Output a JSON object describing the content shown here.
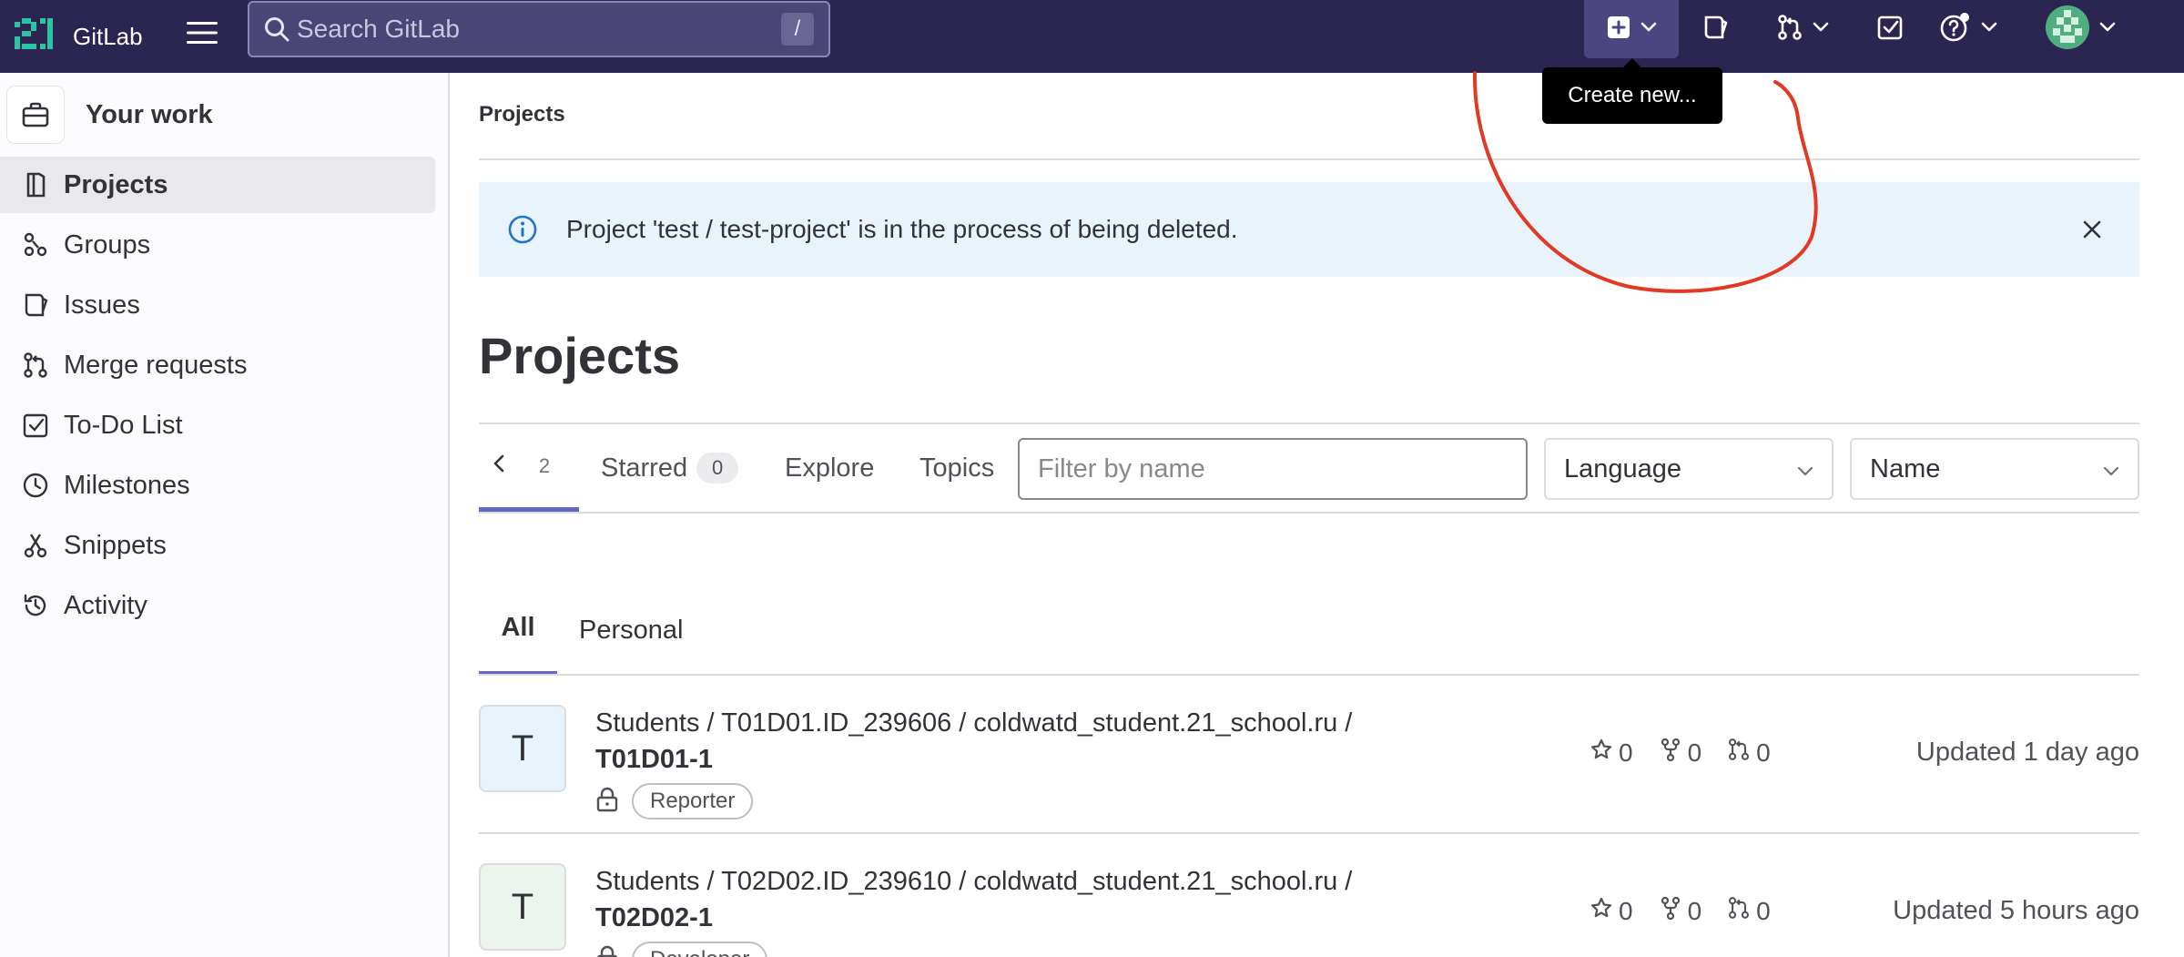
{
  "navbar": {
    "brand": "GitLab",
    "search_placeholder": "Search GitLab",
    "search_shortcut": "/",
    "tooltip": "Create new...",
    "colors": {
      "background": "#2b2651",
      "accent": "#6666c4"
    }
  },
  "sidebar": {
    "context_label": "Your work",
    "items": [
      {
        "label": "Projects",
        "icon": "project-icon",
        "active": true
      },
      {
        "label": "Groups",
        "icon": "group-icon"
      },
      {
        "label": "Issues",
        "icon": "issues-icon"
      },
      {
        "label": "Merge requests",
        "icon": "merge-request-icon"
      },
      {
        "label": "To-Do List",
        "icon": "todo-icon"
      },
      {
        "label": "Milestones",
        "icon": "clock-icon"
      },
      {
        "label": "Snippets",
        "icon": "scissors-icon"
      },
      {
        "label": "Activity",
        "icon": "history-icon"
      }
    ]
  },
  "main": {
    "breadcrumb": "Projects",
    "alert": "Project 'test / test-project' is in the process of being deleted.",
    "title": "Projects",
    "tabs": {
      "first_count": "2",
      "starred": "Starred",
      "starred_count": "0",
      "explore": "Explore",
      "topics": "Topics"
    },
    "filter_placeholder": "Filter by name",
    "language_select": "Language",
    "sort_select": "Name",
    "subtabs": {
      "all": "All",
      "personal": "Personal"
    },
    "projects": [
      {
        "avatar": "T",
        "path": "Students / T01D01.ID_239606 / coldwatd_student.21_school.ru /",
        "name": "T01D01-1",
        "role": "Reporter",
        "stars": "0",
        "forks": "0",
        "merge_requests": "0",
        "updated": "Updated 1 day ago"
      },
      {
        "avatar": "T",
        "path": "Students / T02D02.ID_239610 / coldwatd_student.21_school.ru /",
        "name": "T02D02-1",
        "role": "Developer",
        "stars": "0",
        "forks": "0",
        "merge_requests": "0",
        "updated": "Updated 5 hours ago"
      }
    ]
  }
}
